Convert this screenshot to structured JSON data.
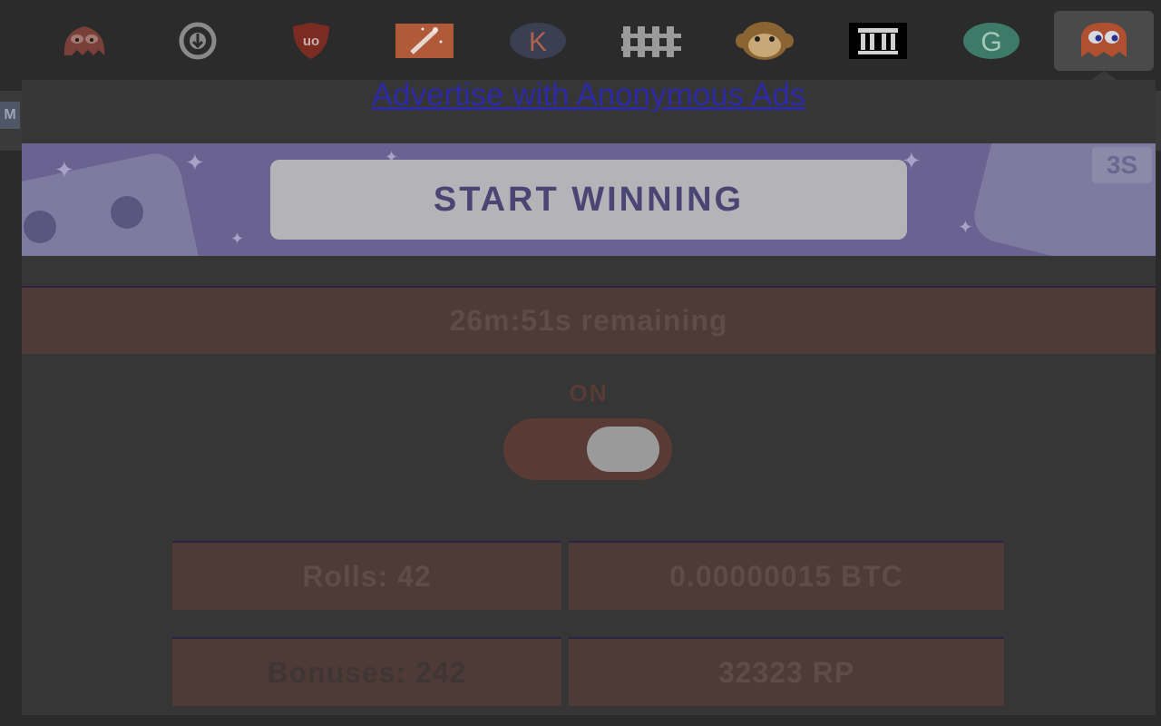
{
  "toolbar": {
    "extensions": [
      {
        "icon": "ghost-face-icon",
        "color": "#7a3f38"
      },
      {
        "icon": "download-circle-icon",
        "color": "#8a8a8a"
      },
      {
        "icon": "ublock-origin-icon",
        "label": "uo",
        "color": "#7a2b22"
      },
      {
        "icon": "magic-wand-icon",
        "color": "#b05a3a"
      },
      {
        "icon": "k-circle-icon",
        "label": "K",
        "color": "#3a3f52"
      },
      {
        "icon": "fence-icon",
        "color": "#9a9a9a"
      },
      {
        "icon": "monkey-icon",
        "color": "#a07840"
      },
      {
        "icon": "museum-icon",
        "color": "#000000"
      },
      {
        "icon": "g-circle-icon",
        "label": "G",
        "color": "#3d7a67"
      },
      {
        "icon": "pacman-ghost-icon",
        "color": "#b05030"
      }
    ]
  },
  "background": {
    "tag": "M"
  },
  "popup": {
    "advert_link": "Advertise with Anonymous Ads",
    "banner": {
      "button_label": "START WINNING",
      "badge": "3S"
    },
    "timer": "26m:51s remaining",
    "status_label": "ON",
    "toggle_on": true,
    "stats": {
      "rolls": "Rolls: 42",
      "btc": "0.00000015 BTC",
      "bonuses": "Bonuses: 242",
      "rp": "32323 RP"
    }
  }
}
